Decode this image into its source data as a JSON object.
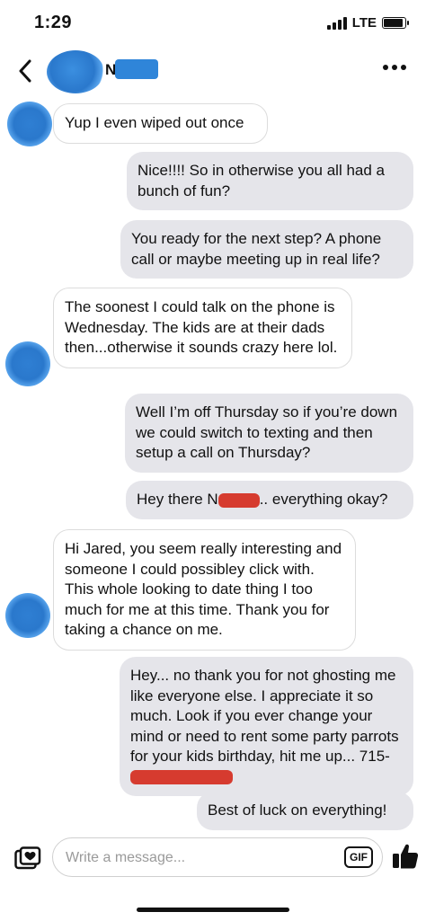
{
  "status_bar": {
    "time": "1:29",
    "network": "LTE",
    "battery_level": 0.9
  },
  "header": {
    "contact_name": "N"
  },
  "messages": [
    {
      "dir": "in",
      "text": "Yup I even wiped out once"
    },
    {
      "dir": "out",
      "text": "Nice!!!! So in otherwise you all had a bunch of fun?"
    },
    {
      "dir": "out",
      "text": "You ready for the next step? A phone call or maybe meeting up in real life?"
    },
    {
      "dir": "in",
      "text": "The soonest I could talk on the phone is Wednesday. The kids are at their dads then...otherwise it sounds crazy here lol."
    },
    {
      "dir": "out",
      "text": "Well I’m off Thursday so if you’re down we could switch to texting and then setup a call on Thursday?"
    },
    {
      "dir": "out",
      "text_before": "Hey there N",
      "text_after": ".. everything okay?"
    },
    {
      "dir": "in",
      "text": "Hi Jared, you seem really interesting and someone I could possibley click with. This whole looking to date thing I too much for me at this time. Thank you for taking a chance on me."
    },
    {
      "dir": "out",
      "text": "Hey... no thank you for not ghosting me like everyone else. I appreciate it so much. Look if you ever change your mind or need to rent some party parrots for your kids birthday, hit me up... 715-"
    },
    {
      "dir": "out",
      "text": "Best of luck on everything!"
    }
  ],
  "composer": {
    "placeholder": "Write a message...",
    "gif_label": "GIF"
  },
  "colors": {
    "incoming_bg": "#ffffff",
    "outgoing_bg": "#e5e5ea",
    "redaction_blue": "#2f85d9",
    "redaction_red": "#d63b2f"
  }
}
